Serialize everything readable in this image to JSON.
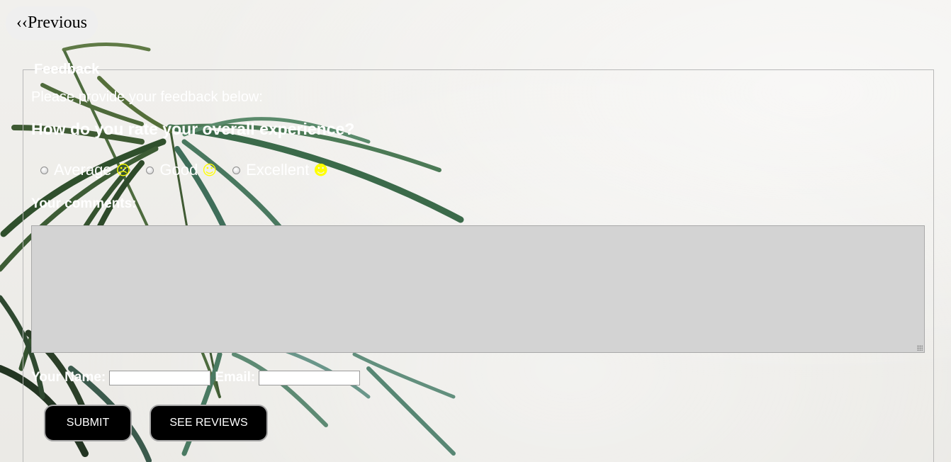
{
  "nav": {
    "previous_label": "‹‹Previous"
  },
  "feedback": {
    "legend": "Feedback",
    "intro": "Please provide your feedback below:",
    "question": "How do you rate your overall experience?",
    "ratings": [
      {
        "label": "Average",
        "icon": "frown-face-icon",
        "glyph": "☹"
      },
      {
        "label": "Good",
        "icon": "smile-face-icon",
        "glyph": "☺"
      },
      {
        "label": "Excellent",
        "icon": "smile-face-filled-icon",
        "glyph": "☻"
      }
    ],
    "comments_label": "Your comments:",
    "comments_value": "",
    "name_label": "Your Name:",
    "name_value": "",
    "email_label": "Email:",
    "email_value": "",
    "submit_label": "SUBMIT",
    "reviews_label": "SEE REVIEWS"
  },
  "colors": {
    "text": "#ffffff",
    "emoji": "#ffff00",
    "button_bg": "#000000",
    "textarea_bg": "#d3d3d3"
  }
}
